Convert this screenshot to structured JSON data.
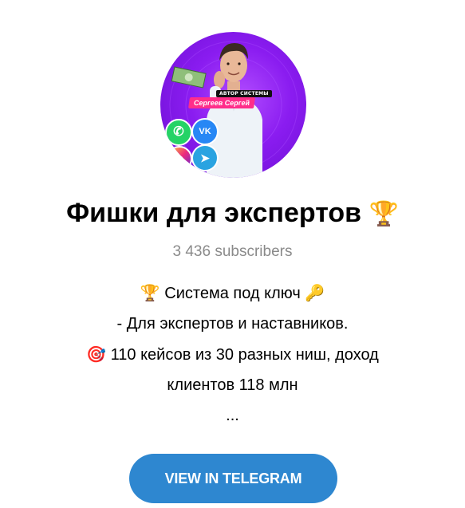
{
  "channel": {
    "avatar": {
      "badge_text": "АВТОР СИСТЕМЫ",
      "name_text": "Сергеев Сергей",
      "icons": [
        "whatsapp-icon",
        "vk-icon",
        "telegram-icon",
        "instagram-icon",
        "money-icon"
      ],
      "colors": {
        "background": "#8a1cf0",
        "name_badge": "#ff2e8a"
      }
    },
    "title": "Фишки для экспертов",
    "title_emoji": "🏆",
    "subscribers": "3 436 subscribers",
    "description": {
      "line1_prefix": "🏆",
      "line1_text": "Система под ключ",
      "line1_suffix": "🔑",
      "line2_text": "- Для экспертов и наставников.",
      "line3_prefix": "🎯",
      "line3_text": "110 кейсов из 30 разных ниш, доход",
      "line4_text": "клиентов 118 млн",
      "line5_text": "..."
    }
  },
  "actions": {
    "view_button": "VIEW IN TELEGRAM",
    "button_color": "#2e87d0"
  }
}
